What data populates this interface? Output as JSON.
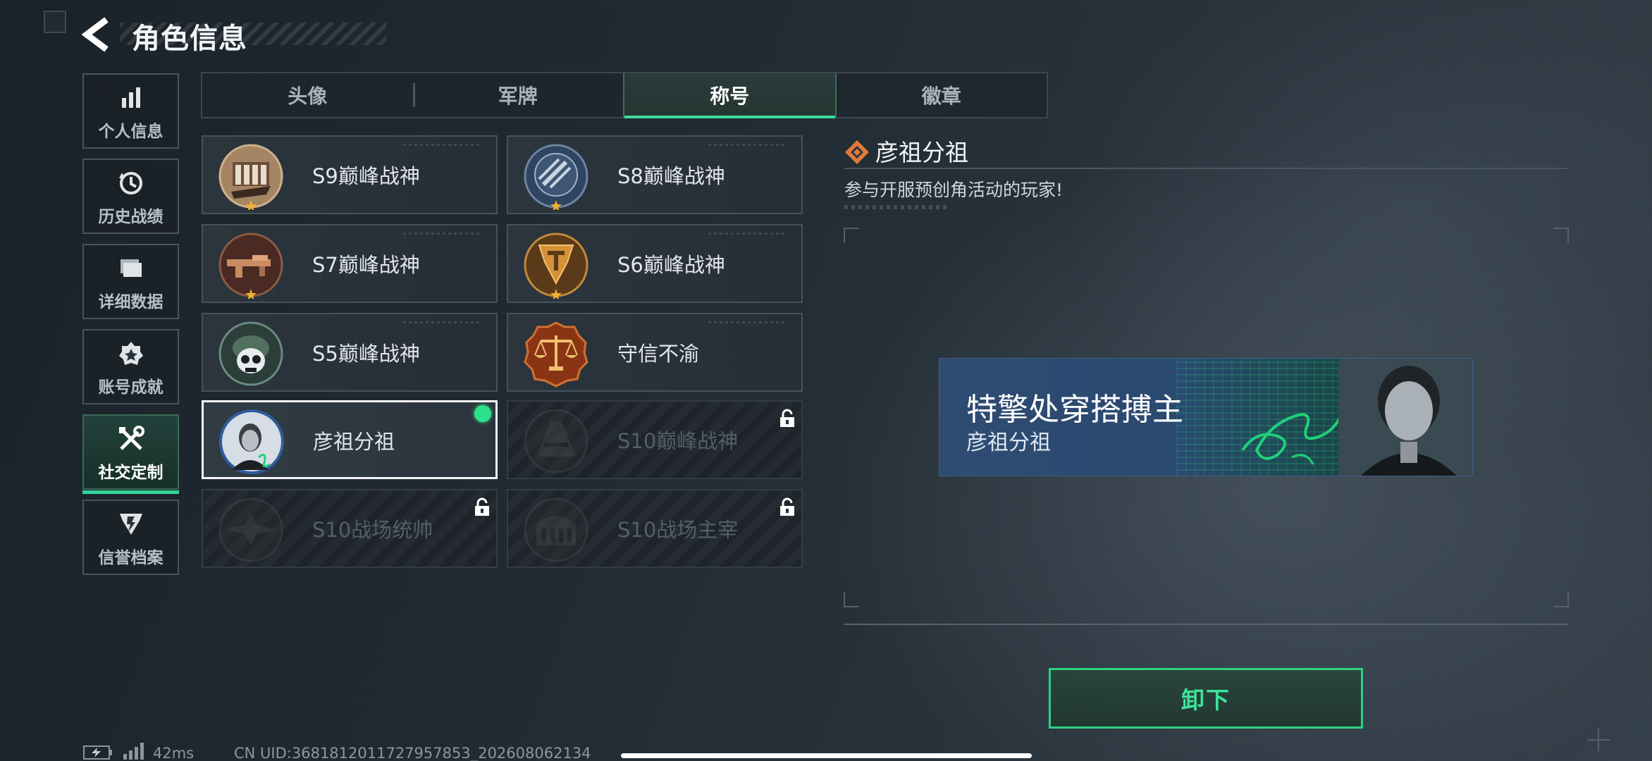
{
  "header": {
    "title": "角色信息"
  },
  "sidebar": {
    "items": [
      {
        "label": "个人信息",
        "icon": "bar-chart-icon",
        "active": false
      },
      {
        "label": "历史战绩",
        "icon": "history-clock-icon",
        "active": false
      },
      {
        "label": "详细数据",
        "icon": "folder-icon",
        "active": false
      },
      {
        "label": "账号成就",
        "icon": "achievement-medal-icon",
        "active": false
      },
      {
        "label": "社交定制",
        "icon": "tools-icon",
        "active": true
      },
      {
        "label": "信誉档案",
        "icon": "credit-shield-icon",
        "active": false
      }
    ]
  },
  "tabs": [
    {
      "label": "头像",
      "active": false
    },
    {
      "label": "军牌",
      "active": false
    },
    {
      "label": "称号",
      "active": true
    },
    {
      "label": "徽章",
      "active": false
    }
  ],
  "titles": [
    {
      "label": "S9巅峰战神",
      "medal": "s9-medal-icon",
      "state": "unlocked"
    },
    {
      "label": "S8巅峰战神",
      "medal": "s8-medal-icon",
      "state": "unlocked"
    },
    {
      "label": "S7巅峰战神",
      "medal": "s7-medal-icon",
      "state": "unlocked"
    },
    {
      "label": "S6巅峰战神",
      "medal": "s6-medal-icon",
      "state": "unlocked"
    },
    {
      "label": "S5巅峰战神",
      "medal": "s5-medal-icon",
      "state": "unlocked"
    },
    {
      "label": "守信不渝",
      "medal": "scales-medal-icon",
      "state": "unlocked"
    },
    {
      "label": "彦祖分祖",
      "medal": "portrait-medal-icon",
      "state": "equipped"
    },
    {
      "label": "S10巅峰战神",
      "medal": "s10-medal-icon",
      "state": "locked"
    },
    {
      "label": "S10战场统帅",
      "medal": "s10-commander-medal-icon",
      "state": "locked"
    },
    {
      "label": "S10战场主宰",
      "medal": "s10-ruler-medal-icon",
      "state": "locked"
    }
  ],
  "detail": {
    "title": "彦祖分祖",
    "description": "参与开服预创角活动的玩家!",
    "banner_main": "特擎处穿搭搏主",
    "banner_sub": "彦祖分祖"
  },
  "actions": {
    "unequip_label": "卸下"
  },
  "status_bar": {
    "ping": "42ms",
    "uid": "CN UID:3681812011727957853_202608062134"
  },
  "colors": {
    "accent_green": "#34d399",
    "equipped_dot": "#2ee08a",
    "detail_icon_orange": "#e07a3a"
  }
}
